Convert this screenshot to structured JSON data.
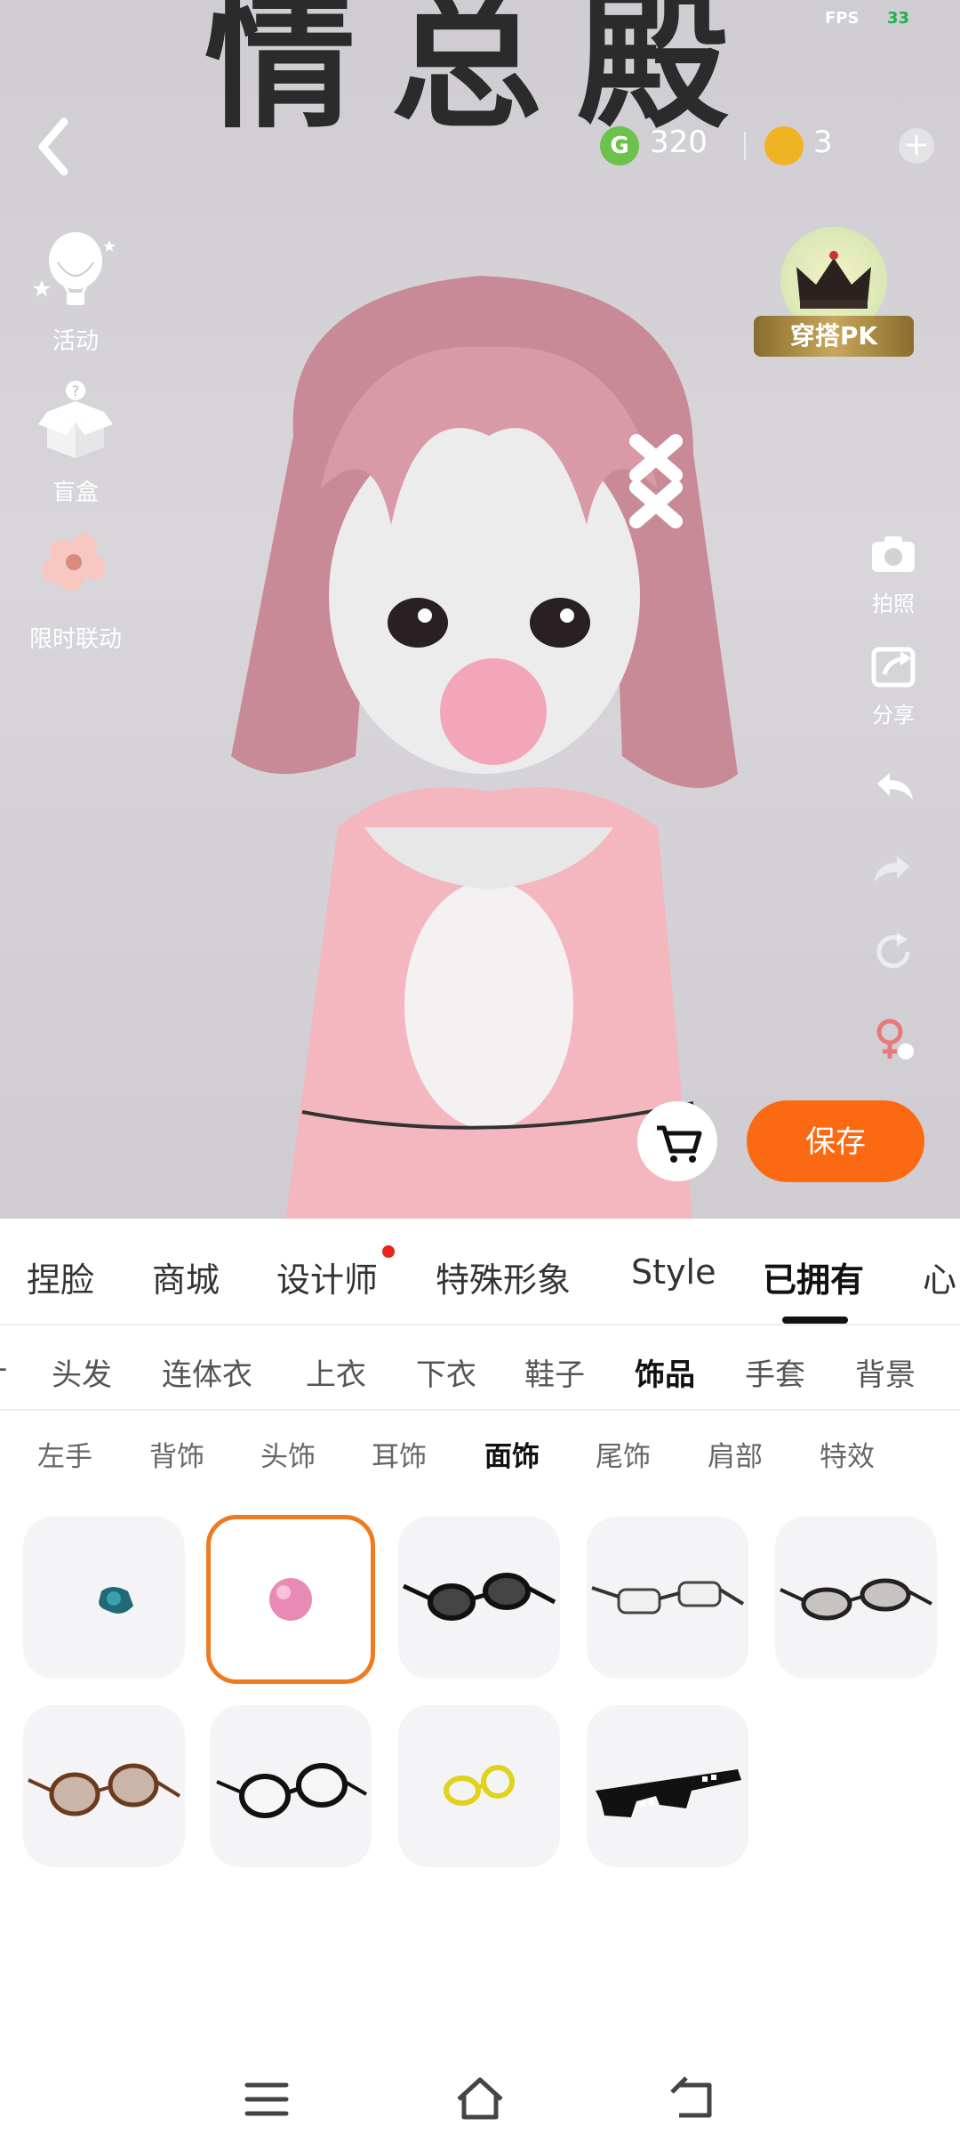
{
  "status": {
    "fps_label": "FPS",
    "fps_value": "33"
  },
  "scene": {
    "background_text": "情总殿",
    "currency": {
      "g_icon": "G",
      "g_value": "320",
      "coin_value": "3"
    },
    "left_menu": [
      {
        "label": "活动",
        "icon": "hot-air-balloon-icon"
      },
      {
        "label": "盲盒",
        "icon": "mystery-box-icon"
      },
      {
        "label": "限时联动",
        "icon": "flower-icon"
      }
    ],
    "pk_label": "穿搭PK",
    "right_tools": [
      {
        "label": "拍照",
        "icon": "camera-icon"
      },
      {
        "label": "分享",
        "icon": "share-icon"
      },
      {
        "label": "",
        "icon": "undo-icon"
      },
      {
        "label": "",
        "icon": "redo-icon"
      },
      {
        "label": "",
        "icon": "reset-icon"
      },
      {
        "label": "",
        "icon": "gender-switch-icon"
      }
    ],
    "save_label": "保存"
  },
  "tabs": [
    "捏脸",
    "商城",
    "设计师",
    "特殊形象",
    "Style",
    "已拥有",
    "心"
  ],
  "active_tab": "已拥有",
  "categories": [
    "-",
    "头发",
    "连体衣",
    "上衣",
    "下衣",
    "鞋子",
    "饰品",
    "手套",
    "背景"
  ],
  "active_category": "饰品",
  "subcategories": [
    "左手",
    "背饰",
    "头饰",
    "耳饰",
    "面饰",
    "尾饰",
    "肩部",
    "特效"
  ],
  "active_subcategory": "面饰",
  "items": [
    {
      "name": "teal-pacifier",
      "selected": false
    },
    {
      "name": "pink-bubble",
      "selected": true
    },
    {
      "name": "dark-sunglasses",
      "selected": false
    },
    {
      "name": "rimless-glasses",
      "selected": false
    },
    {
      "name": "grey-tinted-glasses",
      "selected": false
    },
    {
      "name": "brown-round-glasses",
      "selected": false
    },
    {
      "name": "black-round-glasses",
      "selected": false
    },
    {
      "name": "yellow-glasses",
      "selected": false
    },
    {
      "name": "pixel-sunglasses",
      "selected": false
    }
  ],
  "colors": {
    "accent": "#fb6a13",
    "selected_border": "#f07a1e",
    "red_dot": "#e8241e"
  }
}
